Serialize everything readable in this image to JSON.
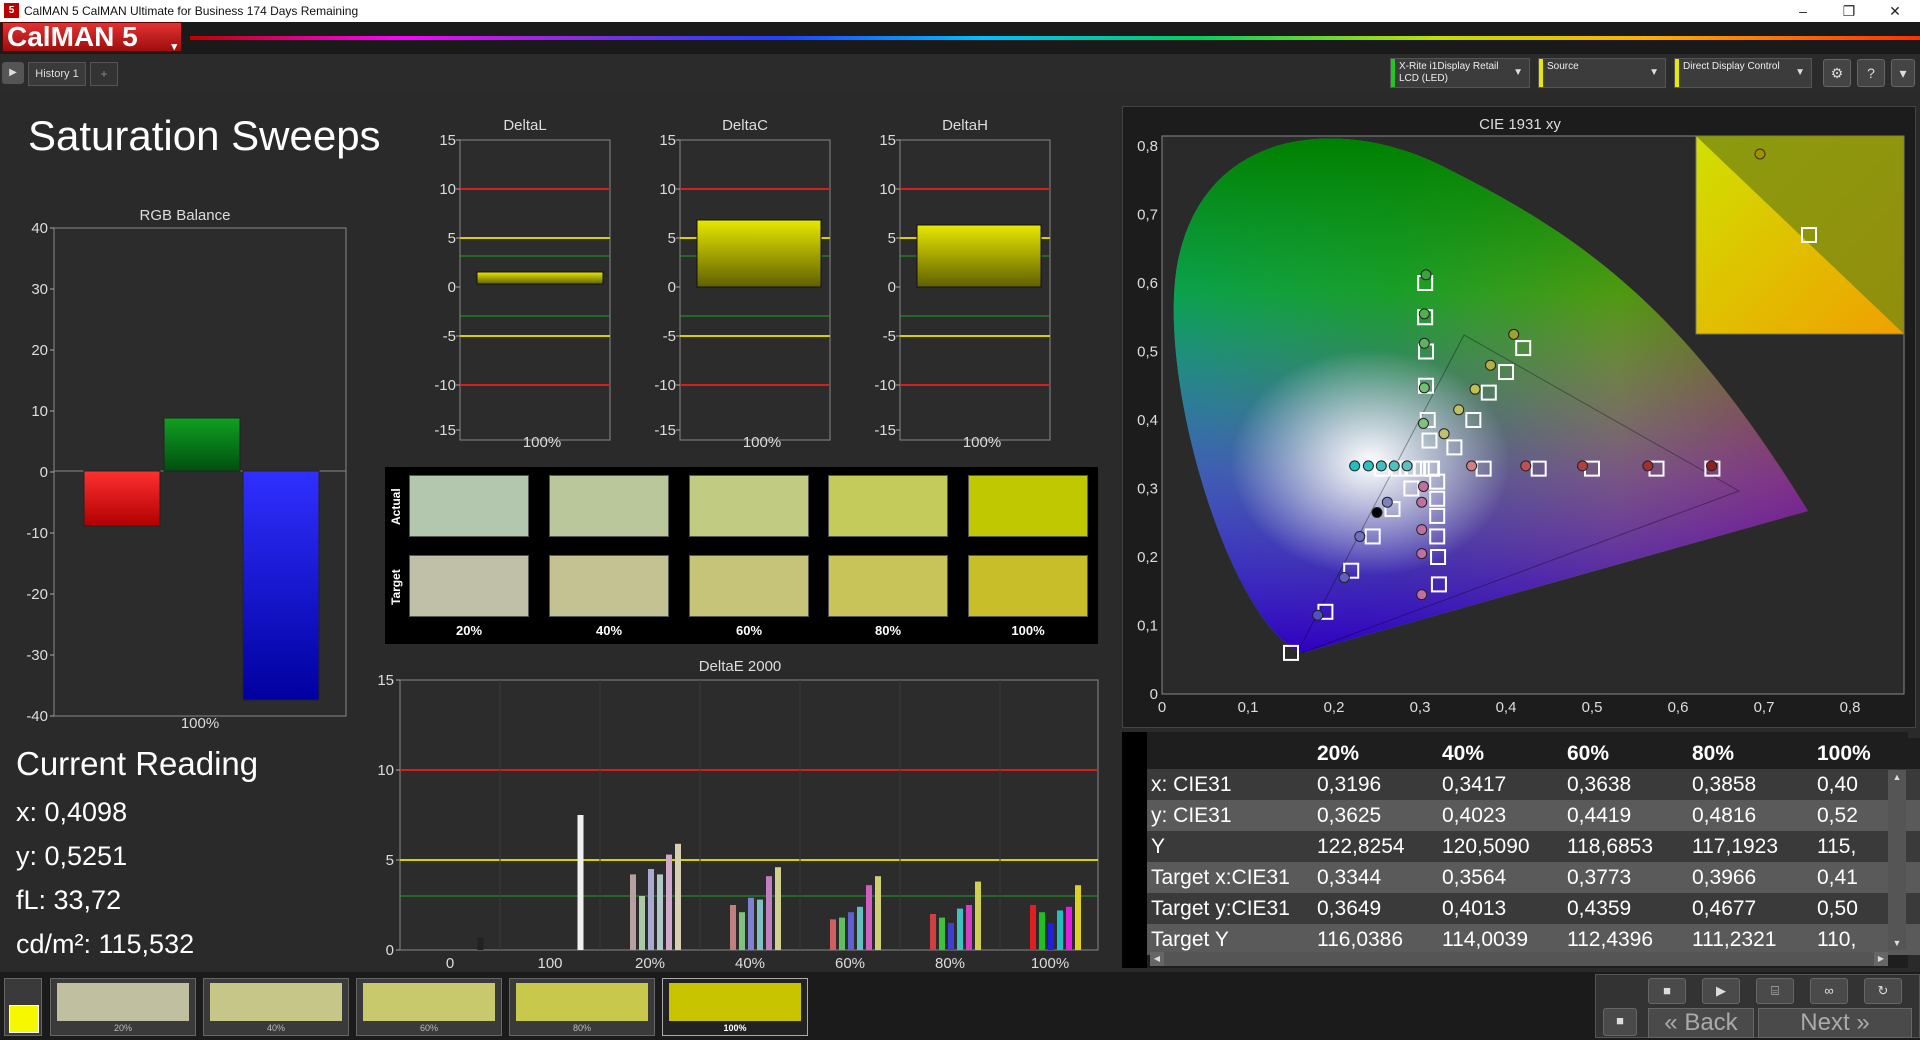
{
  "window": {
    "title": "CalMAN 5 CalMAN Ultimate for Business 174 Days Remaining",
    "app_icon_text": "5",
    "minimize": "–",
    "restore": "❐",
    "close": "✕"
  },
  "brand": {
    "label": "CalMAN 5",
    "caret": "▾"
  },
  "tabs": {
    "play": "▶",
    "history": "History 1",
    "add": "+"
  },
  "devices": [
    {
      "line1": "X-Rite i1Display Retail",
      "line2": "LCD (LED)",
      "color": "#22c822"
    },
    {
      "line1": "Source",
      "line2": "",
      "color": "#e8e800"
    },
    {
      "line1": "Direct Display Control",
      "line2": "",
      "color": "#e8e800"
    }
  ],
  "toolbar_icons": [
    "⚙",
    "?",
    "▾"
  ],
  "page_title": "Saturation Sweeps",
  "rgb_balance": {
    "title": "RGB Balance",
    "xlabel": "100%",
    "yticks": [
      "40",
      "30",
      "20",
      "10",
      "0",
      "-10",
      "-20",
      "-30",
      "-40"
    ]
  },
  "delta_charts": [
    {
      "title": "DeltaL",
      "xlabel": "100%"
    },
    {
      "title": "DeltaC",
      "xlabel": "100%"
    },
    {
      "title": "DeltaH",
      "xlabel": "100%"
    }
  ],
  "delta_yticks": [
    "15",
    "10",
    "5",
    "0",
    "-5",
    "-10",
    "-15"
  ],
  "swatches": {
    "actual_label": "Actual",
    "target_label": "Target",
    "labels": [
      "20%",
      "40%",
      "60%",
      "80%",
      "100%"
    ],
    "actual": [
      "#b3c6ae",
      "#bac79b",
      "#c2cb82",
      "#c4cb5b",
      "#bfc800"
    ],
    "target": [
      "#c0c0a8",
      "#c4c292",
      "#c6c478",
      "#c8c45a",
      "#c8be2a"
    ]
  },
  "deltae": {
    "title": "DeltaE 2000",
    "yticks": [
      "15",
      "10",
      "5",
      "0"
    ],
    "xlabels": [
      "0",
      "100",
      "20%",
      "40%",
      "60%",
      "80%",
      "100%"
    ]
  },
  "current_reading": {
    "title": "Current Reading",
    "x": "x: 0,4098",
    "y": "y: 0,5251",
    "fl": "fL: 33,72",
    "cdm2": "cd/m²: 115,532"
  },
  "cie": {
    "title": "CIE 1931 xy",
    "yticks": [
      "0,8",
      "0,7",
      "0,6",
      "0,5",
      "0,4",
      "0,3",
      "0,2",
      "0,1",
      "0"
    ],
    "xticks": [
      "0",
      "0,1",
      "0,2",
      "0,3",
      "0,4",
      "0,5",
      "0,6",
      "0,7",
      "0,8"
    ]
  },
  "table": {
    "headers": [
      "20%",
      "40%",
      "60%",
      "80%",
      "100%"
    ],
    "rows": [
      {
        "label": "x: CIE31",
        "values": [
          "0,3196",
          "0,3417",
          "0,3638",
          "0,3858",
          "0,40"
        ]
      },
      {
        "label": "y: CIE31",
        "values": [
          "0,3625",
          "0,4023",
          "0,4419",
          "0,4816",
          "0,52"
        ]
      },
      {
        "label": "Y",
        "values": [
          "122,8254",
          "120,5090",
          "118,6853",
          "117,1923",
          "115,"
        ]
      },
      {
        "label": "Target x:CIE31",
        "values": [
          "0,3344",
          "0,3564",
          "0,3773",
          "0,3966",
          "0,41"
        ]
      },
      {
        "label": "Target y:CIE31",
        "values": [
          "0,3649",
          "0,4013",
          "0,4359",
          "0,4677",
          "0,50"
        ]
      },
      {
        "label": "Target Y",
        "values": [
          "116,0386",
          "114,0039",
          "112,4396",
          "111,2321",
          "110,"
        ]
      }
    ],
    "scroll_up": "▲",
    "scroll_down": "▼",
    "scroll_left": "◀",
    "scroll_right": "▶"
  },
  "thumbs": [
    {
      "label": "20%",
      "color": "#c0c0a0"
    },
    {
      "label": "40%",
      "color": "#c6c688"
    },
    {
      "label": "60%",
      "color": "#c8c86c"
    },
    {
      "label": "80%",
      "color": "#c8c84c"
    },
    {
      "label": "100%",
      "color": "#c8c400"
    }
  ],
  "nav": {
    "back": "Back",
    "next": "Next",
    "back_icon": "«",
    "next_icon": "»",
    "controls": [
      "■",
      "▶",
      "⌸",
      "∞",
      "↻"
    ],
    "stop": "■"
  }
}
